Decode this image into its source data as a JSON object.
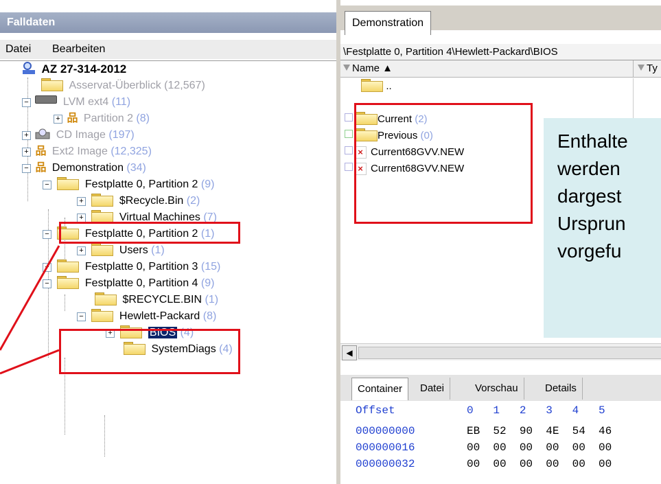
{
  "left_panel": {
    "title": "Falldaten",
    "menu": [
      "Datei",
      "Bearbeiten"
    ],
    "tree": {
      "root": "AZ 27-314-2012",
      "nodes": [
        {
          "label": "Asservat-Überblick",
          "count": "(12,567)"
        },
        {
          "label": "LVM ext4",
          "count": "(11)"
        },
        {
          "label": "Partition 2",
          "count": "(8)"
        },
        {
          "label": "CD Image",
          "count": "(197)"
        },
        {
          "label": "Ext2 Image",
          "count": "(12,325)"
        },
        {
          "label": "Demonstration",
          "count": "(34)"
        },
        {
          "label": "Festplatte 0, Partition 2",
          "count": "(9)"
        },
        {
          "label": "$Recycle.Bin",
          "count": "(2)"
        },
        {
          "label": "Virtual Machines",
          "count": "(7)"
        },
        {
          "label": "Festplatte 0, Partition 2",
          "count": "(1)"
        },
        {
          "label": "Users",
          "count": "(1)"
        },
        {
          "label": "Festplatte 0, Partition 3",
          "count": "(15)"
        },
        {
          "label": "Festplatte 0, Partition 4",
          "count": "(9)"
        },
        {
          "label": "$RECYCLE.BIN",
          "count": "(1)"
        },
        {
          "label": "Hewlett-Packard",
          "count": "(8)"
        },
        {
          "label": "BIOS",
          "count": "(4)"
        },
        {
          "label": "SystemDiags",
          "count": "(4)"
        }
      ]
    }
  },
  "right_panel": {
    "tab": "Demonstration",
    "path": "\\Festplatte 0, Partition 4\\Hewlett-Packard\\BIOS",
    "columns": {
      "name": "Name ▲",
      "type": "Ty"
    },
    "rows": [
      {
        "name": "..",
        "count": ""
      },
      {
        "name": "Current",
        "count": "(2)"
      },
      {
        "name": "Previous",
        "count": "(0)"
      },
      {
        "name": "Current68GVV.NEW",
        "count": ""
      },
      {
        "name": "Current68GVV.NEW",
        "count": ""
      }
    ],
    "note_lines": [
      "Enthalte",
      "werden",
      "dargest",
      "Ursprun",
      "vorgefu"
    ],
    "bottom_tabs": [
      "Container",
      "Datei",
      "Vorschau",
      "Details"
    ],
    "hex": {
      "header": "Offset",
      "header_cols": "0   1   2   3   4   5",
      "rows": [
        {
          "offset": "000000000",
          "bytes": "EB  52  90  4E  54  46"
        },
        {
          "offset": "000000016",
          "bytes": "00  00  00  00  00  00"
        },
        {
          "offset": "000000032",
          "bytes": "00  00  00  00  00  00"
        }
      ]
    }
  },
  "colors": {
    "annotation": "#e0101a",
    "count": "#8fa3e0",
    "offset": "#1f3fd0",
    "note_bg": "#d9eef1"
  },
  "icons": [
    "magnifier-root-icon",
    "folder-icon",
    "drive-icon",
    "network-partition-icon",
    "cd-icon",
    "deleted-file-icon",
    "filter-icon"
  ]
}
